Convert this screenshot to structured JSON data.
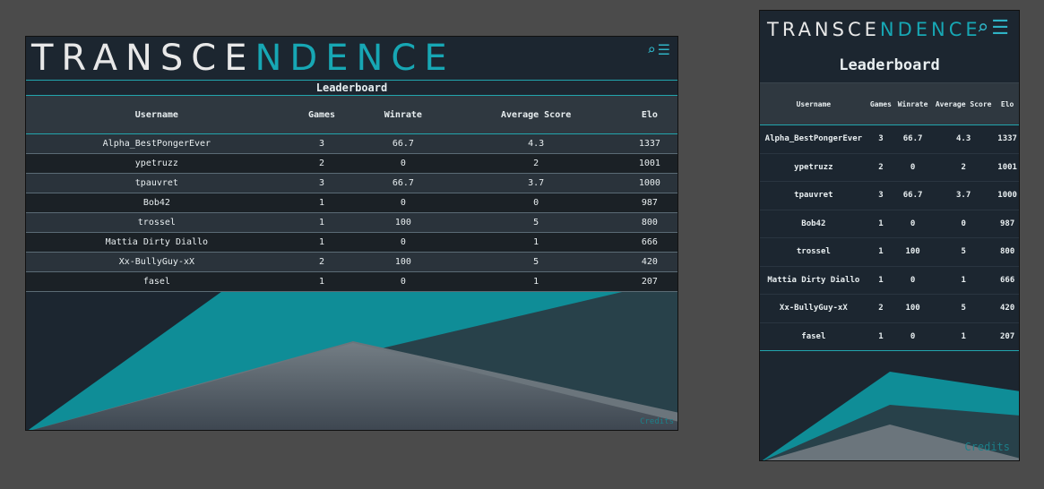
{
  "brand": {
    "logo_prefix": "TRANSCE",
    "logo_accent": "NDENCE",
    "accent_color": "#17a7b4"
  },
  "header_icons": {
    "search": "🔍",
    "menu": "☰"
  },
  "leaderboard": {
    "title": "Leaderboard",
    "columns": [
      "Username",
      "Games",
      "Winrate",
      "Average Score",
      "Elo"
    ],
    "rows": [
      [
        "Alpha_BestPongerEver",
        "3",
        "66.7",
        "4.3",
        "1337"
      ],
      [
        "ypetruzz",
        "2",
        "0",
        "2",
        "1001"
      ],
      [
        "tpauvret",
        "3",
        "66.7",
        "3.7",
        "1000"
      ],
      [
        "Bob42",
        "1",
        "0",
        "0",
        "987"
      ],
      [
        "trossel",
        "1",
        "100",
        "5",
        "800"
      ],
      [
        "Mattia Dirty Diallo",
        "1",
        "0",
        "1",
        "666"
      ],
      [
        "Xx-BullyGuy-xX",
        "2",
        "100",
        "5",
        "420"
      ],
      [
        "fasel",
        "1",
        "0",
        "1",
        "207"
      ]
    ]
  },
  "footer": {
    "credits": "Credits"
  }
}
